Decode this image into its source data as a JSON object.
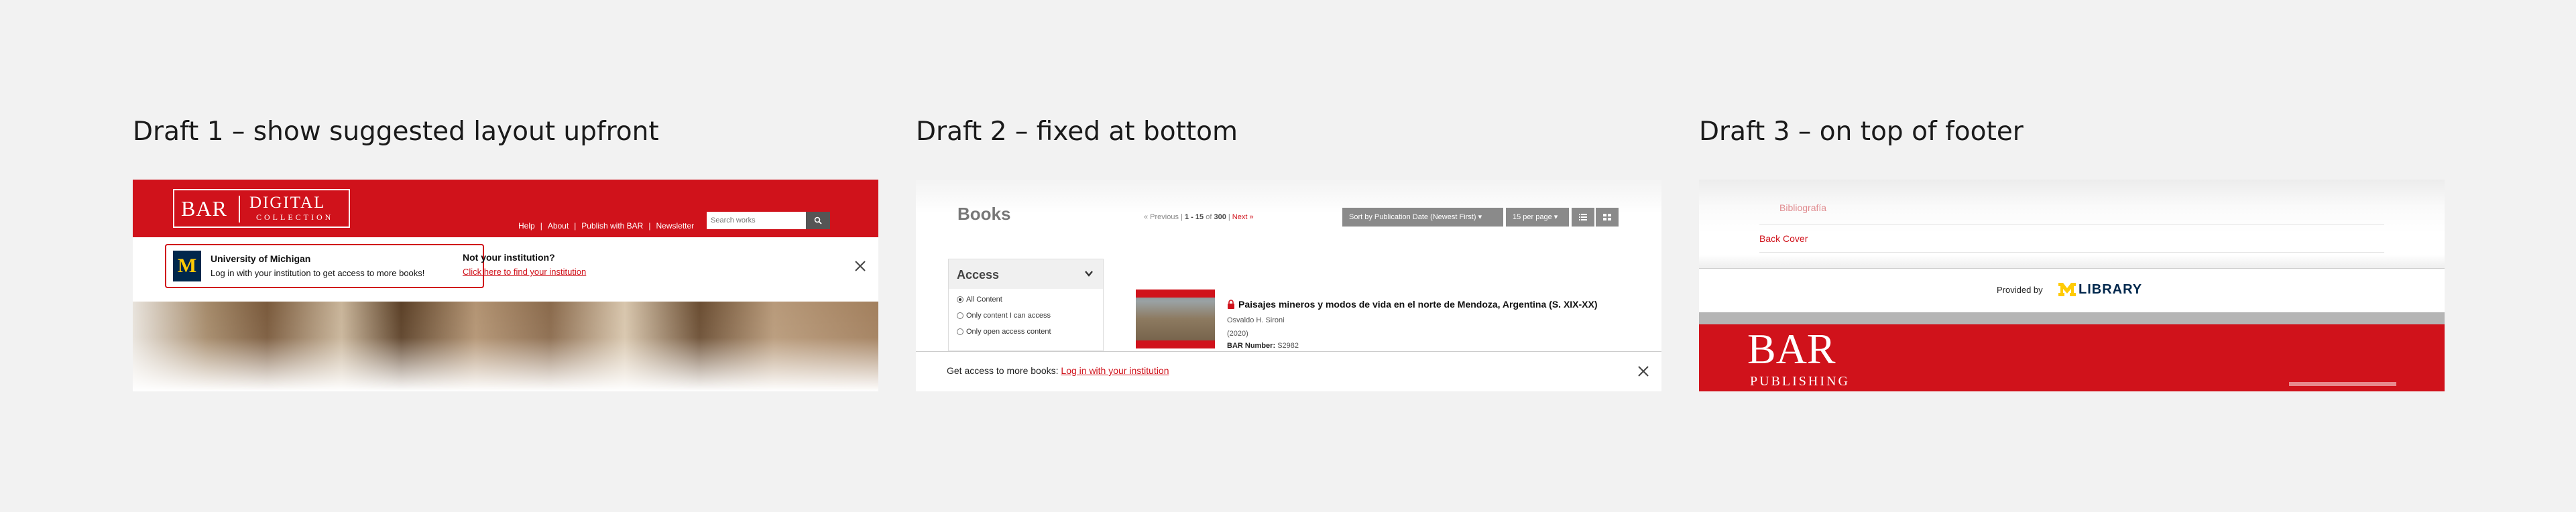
{
  "drafts": [
    {
      "title": "Draft 1 – show suggested layout upfront"
    },
    {
      "title": "Draft 2 – fixed at bottom"
    },
    {
      "title": "Draft 3 – on top of footer"
    }
  ],
  "d1": {
    "logo": {
      "bar": "BAR",
      "digital": "DIGITAL",
      "collection": "COLLECTION"
    },
    "nav": [
      "Help",
      "About",
      "Publish with BAR",
      "Newsletter"
    ],
    "search_placeholder": "Search works",
    "institution": {
      "name": "University of Michigan",
      "logo_letter": "M",
      "message": "Log in with your institution to get access to more books!"
    },
    "not_your": "Not your institution?",
    "find_link": "Click here to find your institution"
  },
  "d2": {
    "title": "Books",
    "pager": {
      "previous": "« Previous",
      "sep": "|",
      "range_prefix": "1",
      "range_dash": "-",
      "range_end": "15",
      "of": "of",
      "total": "300",
      "next": "Next »"
    },
    "sort_label": "Sort by Publication Date (Newest First) ▾",
    "per_page_label": "15 per page ▾",
    "access": {
      "title": "Access",
      "options": [
        "All Content",
        "Only content I can access",
        "Only open access content"
      ]
    },
    "book": {
      "title": "Paisajes mineros y modos de vida en el norte de Mendoza, Argentina (S. XIX-XX)",
      "author": "Osvaldo H. Sironi",
      "year": "(2020)",
      "bar_label": "BAR Number:",
      "bar_number": "S2982"
    },
    "footer": {
      "text": "Get access to more books: ",
      "link": "Log in with your institution"
    }
  },
  "d3": {
    "bibliografia": "Bibliografía",
    "back_cover": "Back Cover",
    "provided_by": "Provided by",
    "library": "LIBRARY",
    "bar": "BAR",
    "publishing": "PUBLISHING"
  },
  "colors": {
    "brand_red": "#d0121b",
    "umich_blue": "#00274c",
    "umich_maize": "#ffcb05"
  }
}
